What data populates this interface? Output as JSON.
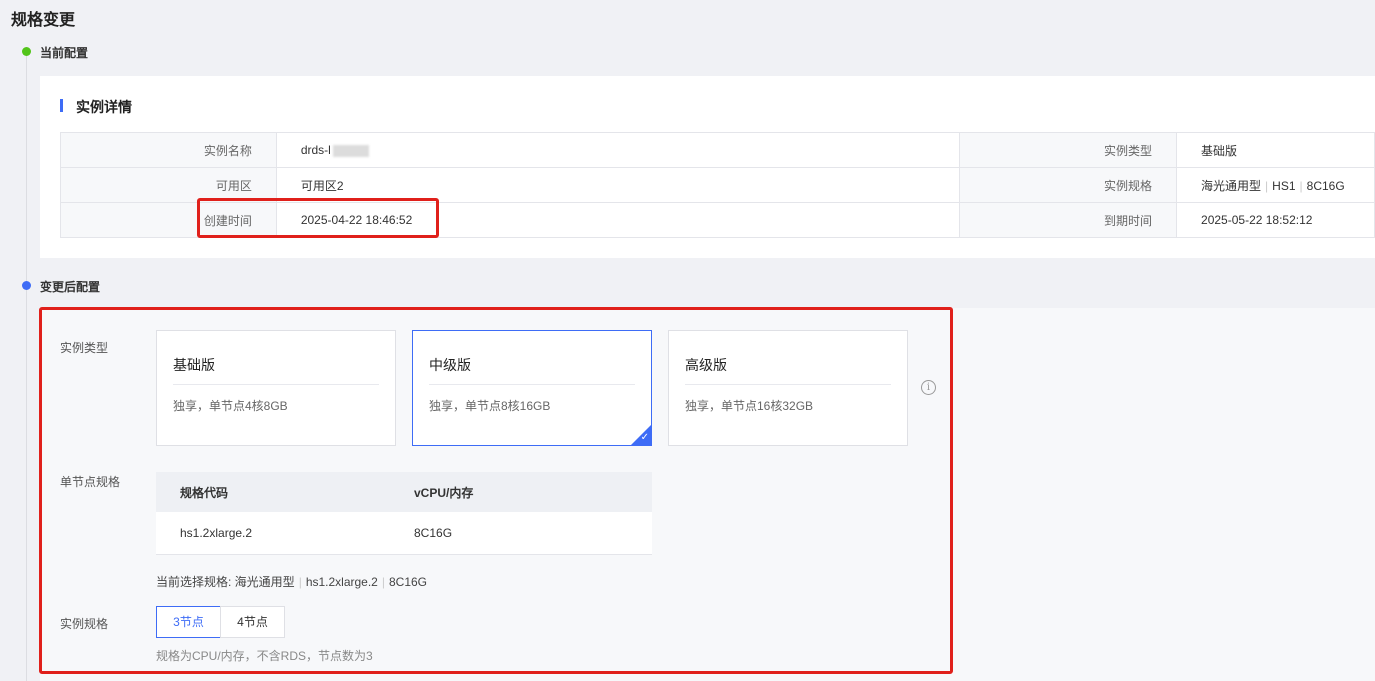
{
  "page": {
    "title": "规格变更"
  },
  "steps": {
    "current": "当前配置",
    "after": "变更后配置"
  },
  "detail": {
    "heading": "实例详情",
    "rows": [
      {
        "k1": "实例名称",
        "v1": "drds-l",
        "k2": "实例类型",
        "v2": "基础版"
      },
      {
        "k1": "可用区",
        "v1": "可用区2",
        "k2": "实例规格",
        "v2a": "海光通用型",
        "v2b": "HS1",
        "v2c": "8C16G"
      },
      {
        "k1": "创建时间",
        "v1": "2025-04-22 18:46:52",
        "k2": "到期时间",
        "v2": "2025-05-22 18:52:12"
      }
    ]
  },
  "form": {
    "type_label": "实例类型",
    "node_spec_label": "单节点规格",
    "instance_spec_label": "实例规格",
    "types": [
      {
        "title": "基础版",
        "desc": "独享，单节点4核8GB"
      },
      {
        "title": "中级版",
        "desc": "独享，单节点8核16GB"
      },
      {
        "title": "高级版",
        "desc": "独享，单节点16核32GB"
      }
    ],
    "check_mark": "✓",
    "info_icon": "i",
    "spec_table": {
      "headers": [
        "规格代码",
        "vCPU/内存"
      ],
      "rows": [
        [
          "hs1.2xlarge.2",
          "8C16G"
        ]
      ]
    },
    "current_spec": {
      "prefix": "当前选择规格: ",
      "a": "海光通用型",
      "b": "hs1.2xlarge.2",
      "c": "8C16G"
    },
    "node_options": [
      "3节点",
      "4节点"
    ],
    "hint": "规格为CPU/内存，不含RDS，节点数为3"
  },
  "colors": {
    "accent": "#3e6cf6",
    "highlight_border": "#e0201b",
    "success": "#52c41a"
  }
}
